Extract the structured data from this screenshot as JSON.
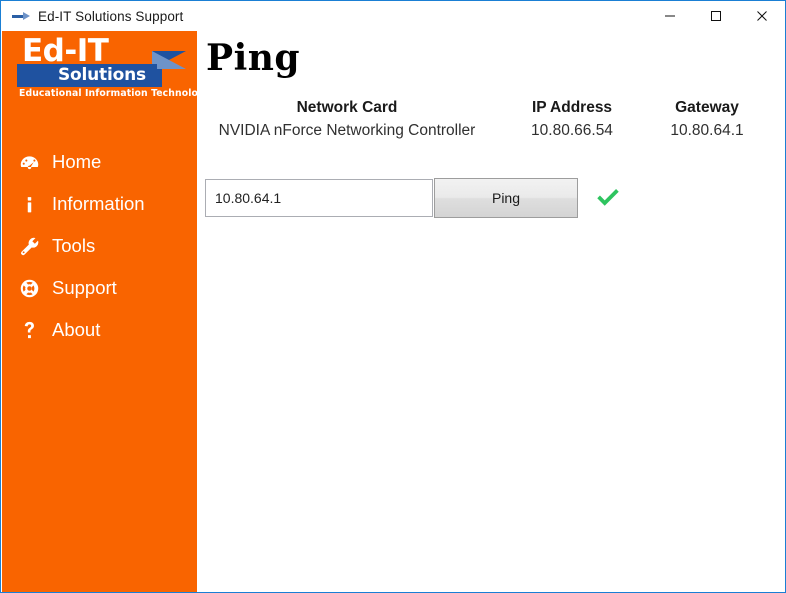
{
  "window": {
    "title": "Ed-IT Solutions Support",
    "icon": "arrow-right-icon",
    "border_color": "#1a7fd4",
    "controls": {
      "minimize": "minimize-icon",
      "maximize": "maximize-icon",
      "close": "close-icon"
    }
  },
  "sidebar": {
    "background_color": "#f96400",
    "logo": {
      "line1": "Ed-IT",
      "line2": "Solutions",
      "tagline": "Educational Information Technology",
      "banner_color": "#1f52a0",
      "arrow_light_color": "#6e93c8"
    },
    "items": [
      {
        "label": "Home",
        "icon": "dashboard-icon"
      },
      {
        "label": "Information",
        "icon": "info-icon"
      },
      {
        "label": "Tools",
        "icon": "wrench-icon"
      },
      {
        "label": "Support",
        "icon": "life-ring-icon"
      },
      {
        "label": "About",
        "icon": "question-mark-icon"
      }
    ]
  },
  "main": {
    "page_title": "Ping",
    "table": {
      "headers": [
        "Network Card",
        "IP Address",
        "Gateway"
      ],
      "rows": [
        [
          "NVIDIA nForce Networking Controller",
          "10.80.66.54",
          "10.80.64.1"
        ]
      ]
    },
    "form": {
      "input_value": "10.80.64.1",
      "input_placeholder": "",
      "button_label": "Ping",
      "status_icon": "check-mark-icon",
      "status_color": "#2ec45f"
    }
  }
}
